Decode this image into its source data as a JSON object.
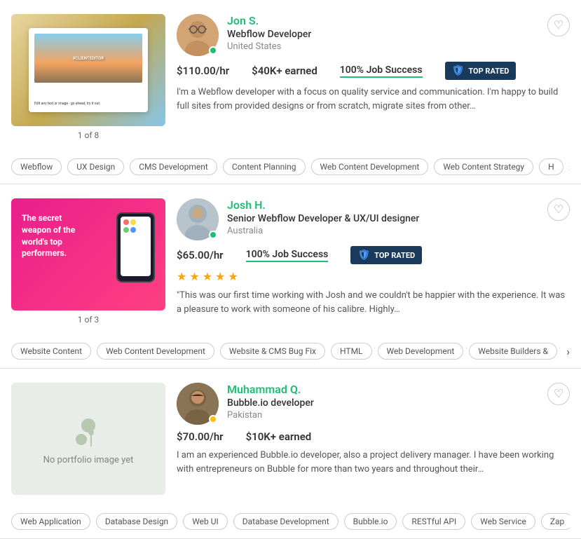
{
  "cards": [
    {
      "id": "jon",
      "name": "Jon S.",
      "title": "Webflow Developer",
      "location": "United States",
      "rate": "$110.00/hr",
      "earned": "$40K+ earned",
      "jobSuccess": "100% Job Success",
      "topRated": true,
      "topRatedLabel": "TOP RATED",
      "bio": "I'm a Webflow developer with a focus on quality service and communication. I'm happy to build full sites from provided designs or from scratch, migrate sites from other…",
      "imageCounter": "1 of 8",
      "tags": [
        "Webflow",
        "UX Design",
        "CMS Development",
        "Content Planning",
        "Web Content Development",
        "Web Content Strategy",
        "H"
      ],
      "hasPortfolio": true,
      "stars": 0,
      "review": ""
    },
    {
      "id": "josh",
      "name": "Josh H.",
      "title": "Senior Webflow Developer & UX/UI designer",
      "location": "Australia",
      "rate": "$65.00/hr",
      "earned": "",
      "jobSuccess": "100% Job Success",
      "topRated": true,
      "topRatedLabel": "TOP RATED",
      "bio": "\"This was our first time working with Josh and we couldn't be happier with the experience. It was a pleasure to work with someone of his calibre. Highly…",
      "imageCounter": "1 of 3",
      "tags": [
        "Website Content",
        "Web Content Development",
        "Website & CMS Bug Fix",
        "HTML",
        "Web Development",
        "Website Builders &"
      ],
      "hasPortfolio": true,
      "stars": 5,
      "review": ""
    },
    {
      "id": "muhammad",
      "name": "Muhammad Q.",
      "title": "Bubble.io developer",
      "location": "Pakistan",
      "rate": "$70.00/hr",
      "earned": "$10K+ earned",
      "jobSuccess": "",
      "topRated": false,
      "topRatedLabel": "",
      "bio": "I am an experienced Bubble.io developer, also a project delivery manager. I have been working with entrepreneurs on Bubble for more than two years and throughout their…",
      "imageCounter": "",
      "tags": [
        "Web Application",
        "Database Design",
        "Web UI",
        "Database Development",
        "Bubble.io",
        "RESTful API",
        "Web Service",
        "Zap"
      ],
      "hasPortfolio": false,
      "noPortfolioText": "No portfolio image yet",
      "stars": 0,
      "review": ""
    }
  ],
  "shieldSymbol": "🛡",
  "heartSymbol": "♡",
  "arrowSymbol": "›"
}
